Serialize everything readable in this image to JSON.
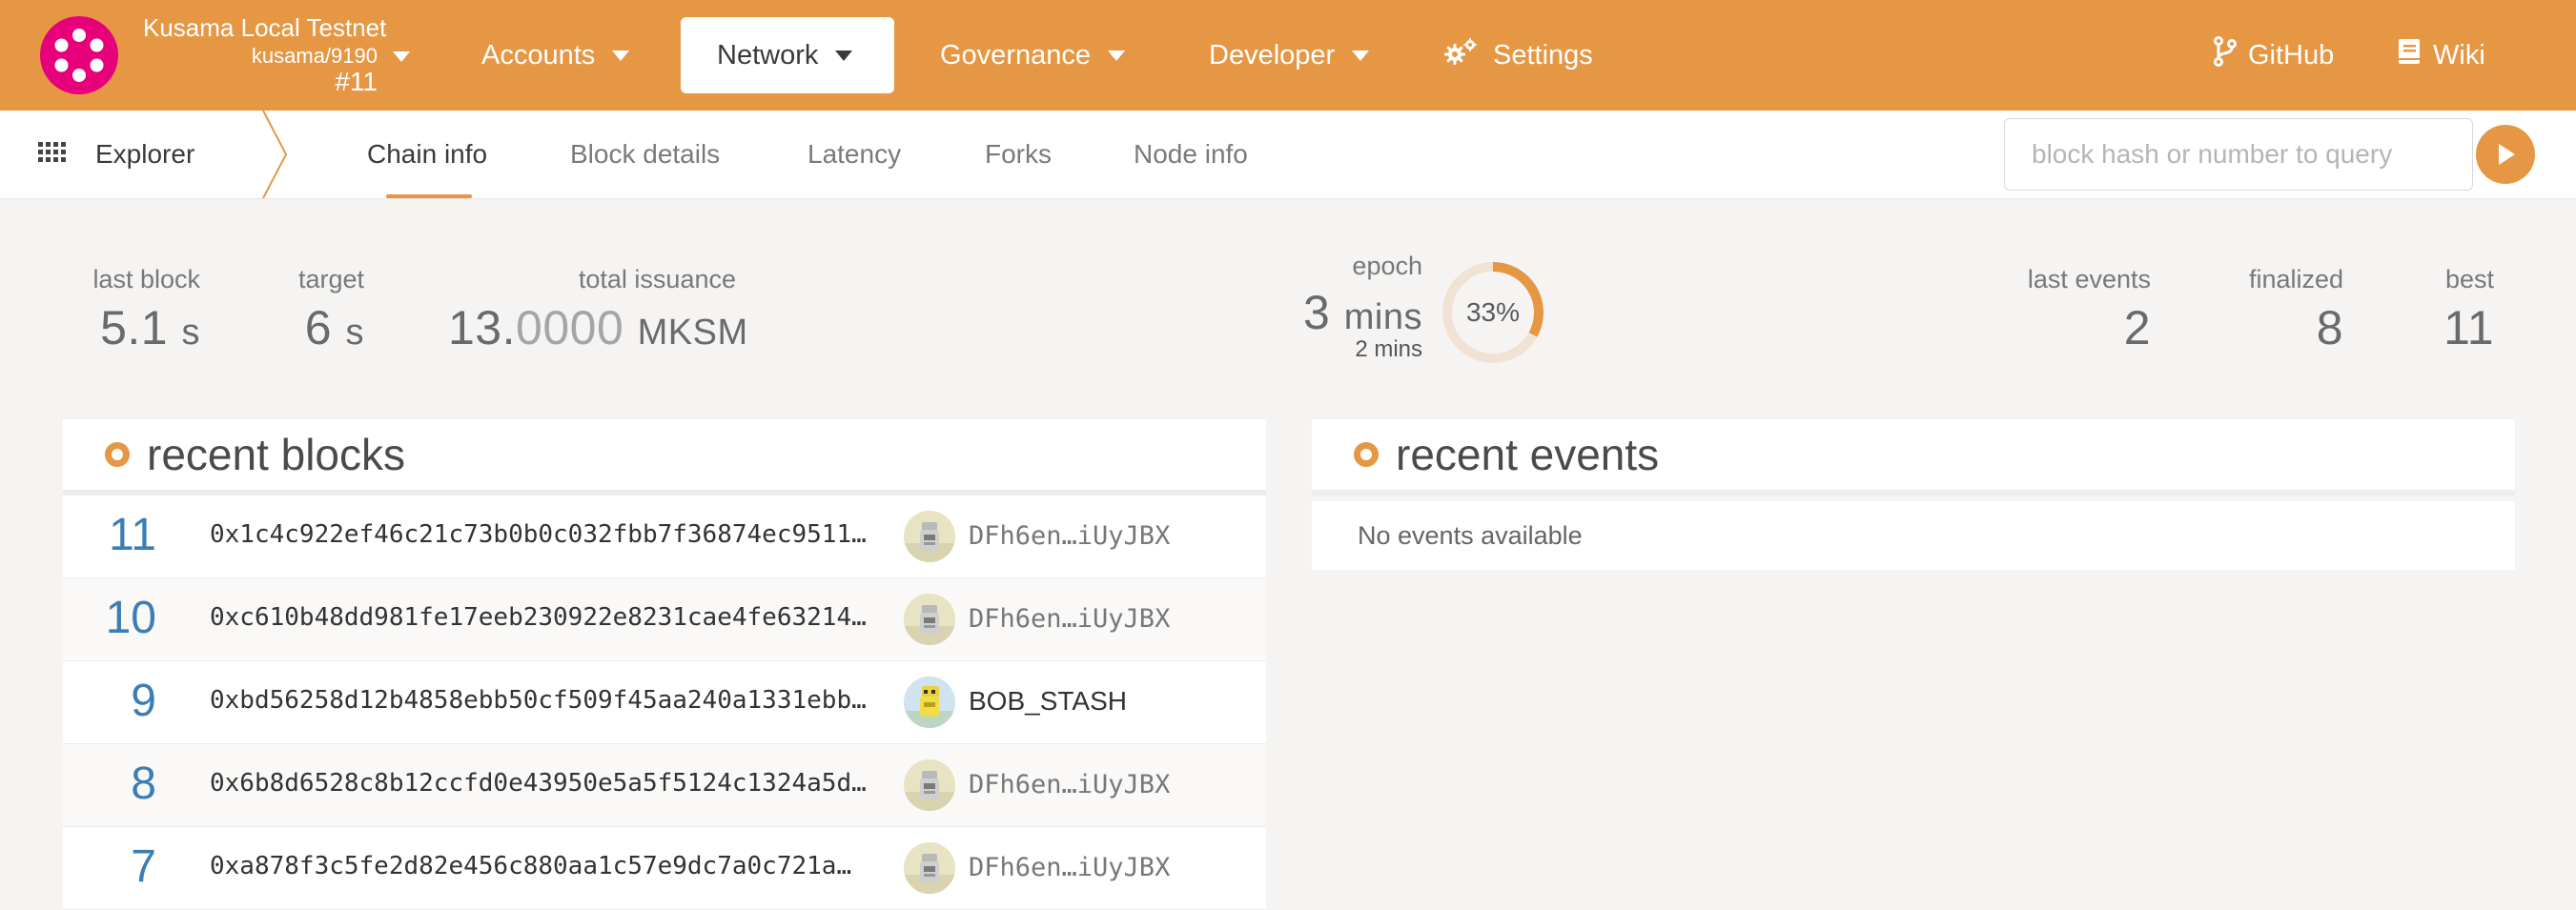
{
  "header": {
    "chain_name": "Kusama Local Testnet",
    "node": "kusama/9190",
    "block_number": "#11",
    "nav": [
      {
        "label": "Accounts"
      },
      {
        "label": "Network"
      },
      {
        "label": "Governance"
      },
      {
        "label": "Developer"
      },
      {
        "label": "Settings"
      }
    ],
    "links": [
      {
        "label": "GitHub"
      },
      {
        "label": "Wiki"
      }
    ]
  },
  "subnav": {
    "section": "Explorer",
    "tabs": [
      {
        "label": "Chain info"
      },
      {
        "label": "Block details"
      },
      {
        "label": "Latency"
      },
      {
        "label": "Forks"
      },
      {
        "label": "Node info"
      }
    ],
    "query_placeholder": "block hash or number to query"
  },
  "summary": {
    "last_block": {
      "label": "last block",
      "value": "5.1",
      "unit": "s"
    },
    "target": {
      "label": "target",
      "value": "6",
      "unit": "s"
    },
    "total_issuance": {
      "label": "total issuance",
      "value_main": "13.",
      "value_dim": "0000",
      "unit": "MKSM"
    },
    "epoch": {
      "label": "epoch",
      "value": "3",
      "unit": "mins",
      "remaining": "2 mins",
      "progress_percent": 33,
      "progress_text": "33%"
    },
    "last_events": {
      "label": "last events",
      "value": "2"
    },
    "finalized": {
      "label": "finalized",
      "value": "8"
    },
    "best": {
      "label": "best",
      "value": "11"
    }
  },
  "recent_blocks": {
    "title": "recent blocks",
    "rows": [
      {
        "number": "11",
        "hash": "0x1c4c922ef46c21c73b0b0c032fbb7f36874ec9511…",
        "author": "DFh6en…iUyJBX"
      },
      {
        "number": "10",
        "hash": "0xc610b48dd981fe17eeb230922e8231cae4fe63214…",
        "author": "DFh6en…iUyJBX"
      },
      {
        "number": "9",
        "hash": "0xbd56258d12b4858ebb50cf509f45aa240a1331ebb…",
        "author": "BOB_STASH"
      },
      {
        "number": "8",
        "hash": "0x6b8d6528c8b12ccfd0e43950e5a5f5124c1324a5d…",
        "author": "DFh6en…iUyJBX"
      },
      {
        "number": "7",
        "hash": "0xa878f3c5fe2d82e456c880aa1c57e9dc7a0c721a…",
        "author": "DFh6en…iUyJBX"
      }
    ]
  },
  "recent_events": {
    "title": "recent events",
    "empty_text": "No events available"
  },
  "colors": {
    "accent": "#e59744",
    "block_number": "#3c7eb4",
    "logo": "#e6007a"
  }
}
